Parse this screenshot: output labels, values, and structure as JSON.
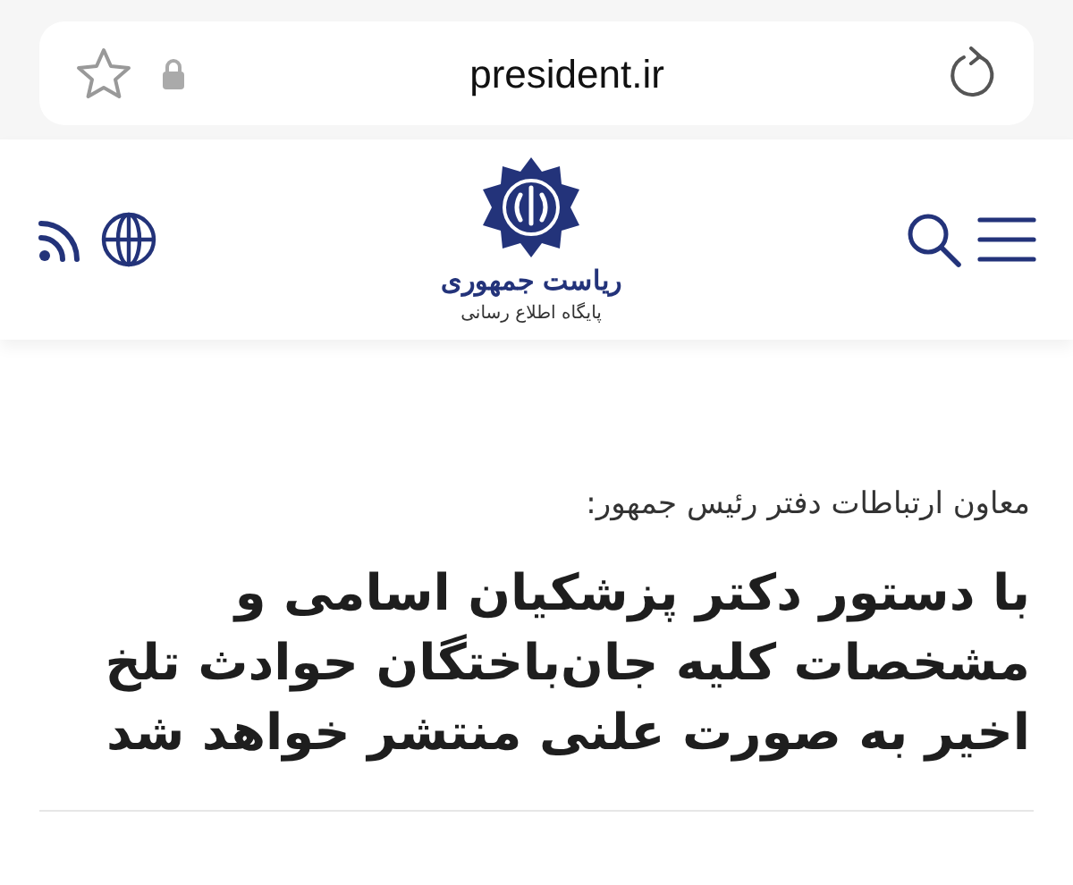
{
  "address_bar": {
    "url": "president.ir"
  },
  "header": {
    "logo_title": "ریاست جمهوری",
    "logo_subtitle": "پایگاه اطلاع رسانی"
  },
  "article": {
    "kicker": "معاون ارتباطات دفتر رئیس جمهور:",
    "headline": "با دستور دکتر پزشکیان اسامی و مشخصات کلیه جان‌باختگان حوادث تلخ اخیر به صورت علنی منتشر خواهد شد"
  }
}
